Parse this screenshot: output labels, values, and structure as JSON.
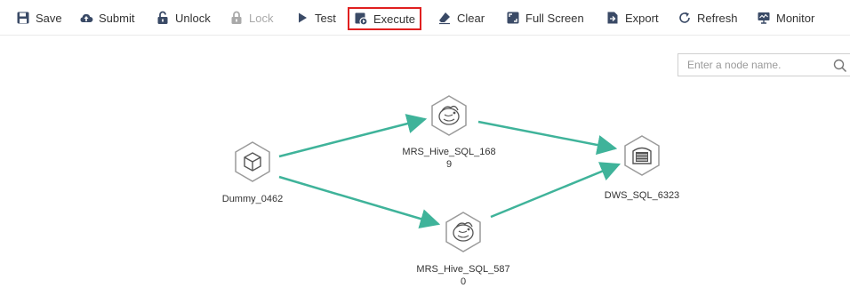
{
  "toolbar": {
    "save": "Save",
    "submit": "Submit",
    "unlock": "Unlock",
    "lock": "Lock",
    "test": "Test",
    "execute": "Execute",
    "clear": "Clear",
    "full_screen": "Full Screen",
    "export": "Export",
    "refresh": "Refresh",
    "monitor": "Monitor"
  },
  "search": {
    "placeholder": "Enter a node name."
  },
  "nodes": {
    "dummy": {
      "name": "Dummy_0462",
      "icon": "cube-icon"
    },
    "hive_top": {
      "name_line1": "MRS_Hive_SQL_168",
      "name_line2": "9",
      "icon": "hive-bee-icon"
    },
    "hive_bottom": {
      "name_line1": "MRS_Hive_SQL_587",
      "name_line2": "0",
      "icon": "hive-bee-icon"
    },
    "dws": {
      "name": "DWS_SQL_6323",
      "icon": "database-icon"
    }
  },
  "colors": {
    "edge": "#3fb39a",
    "toolbar_icon": "#3a4a66",
    "highlight_border": "#e02020",
    "node_border": "#9a9a9a"
  }
}
